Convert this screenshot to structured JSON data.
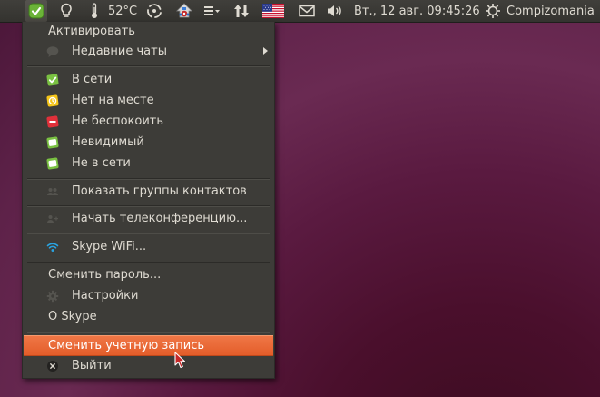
{
  "panel": {
    "temperature": "52°C",
    "clock": "Вт., 12 авг. 09:45:26",
    "hostname": "Compizomania",
    "icons": [
      "skype-status-icon",
      "lightbulb-icon",
      "thermometer-icon",
      "spinner-icon",
      "update-icon",
      "menu-list-icon",
      "transfer-arrows-icon",
      "us-flag-icon",
      "mail-icon",
      "volume-icon",
      "power-icon"
    ]
  },
  "menu": {
    "activate": "Активировать",
    "recent_chats": "Недавние чаты",
    "status_online": "В сети",
    "status_away": "Нет на месте",
    "status_dnd": "Не беспокоить",
    "status_invisible": "Невидимый",
    "status_offline": "Не в сети",
    "show_groups": "Показать группы контактов",
    "start_conference": "Начать телеконференцию...",
    "skype_wifi": "Skype WiFi...",
    "change_password": "Сменить пароль...",
    "settings": "Настройки",
    "about": "О Skype",
    "switch_account": "Сменить учетную запись",
    "quit": "Выйти"
  },
  "colors": {
    "online": "#7ac142",
    "away": "#f5c518",
    "dnd": "#e0303a",
    "highlight": "#ea6a37"
  }
}
